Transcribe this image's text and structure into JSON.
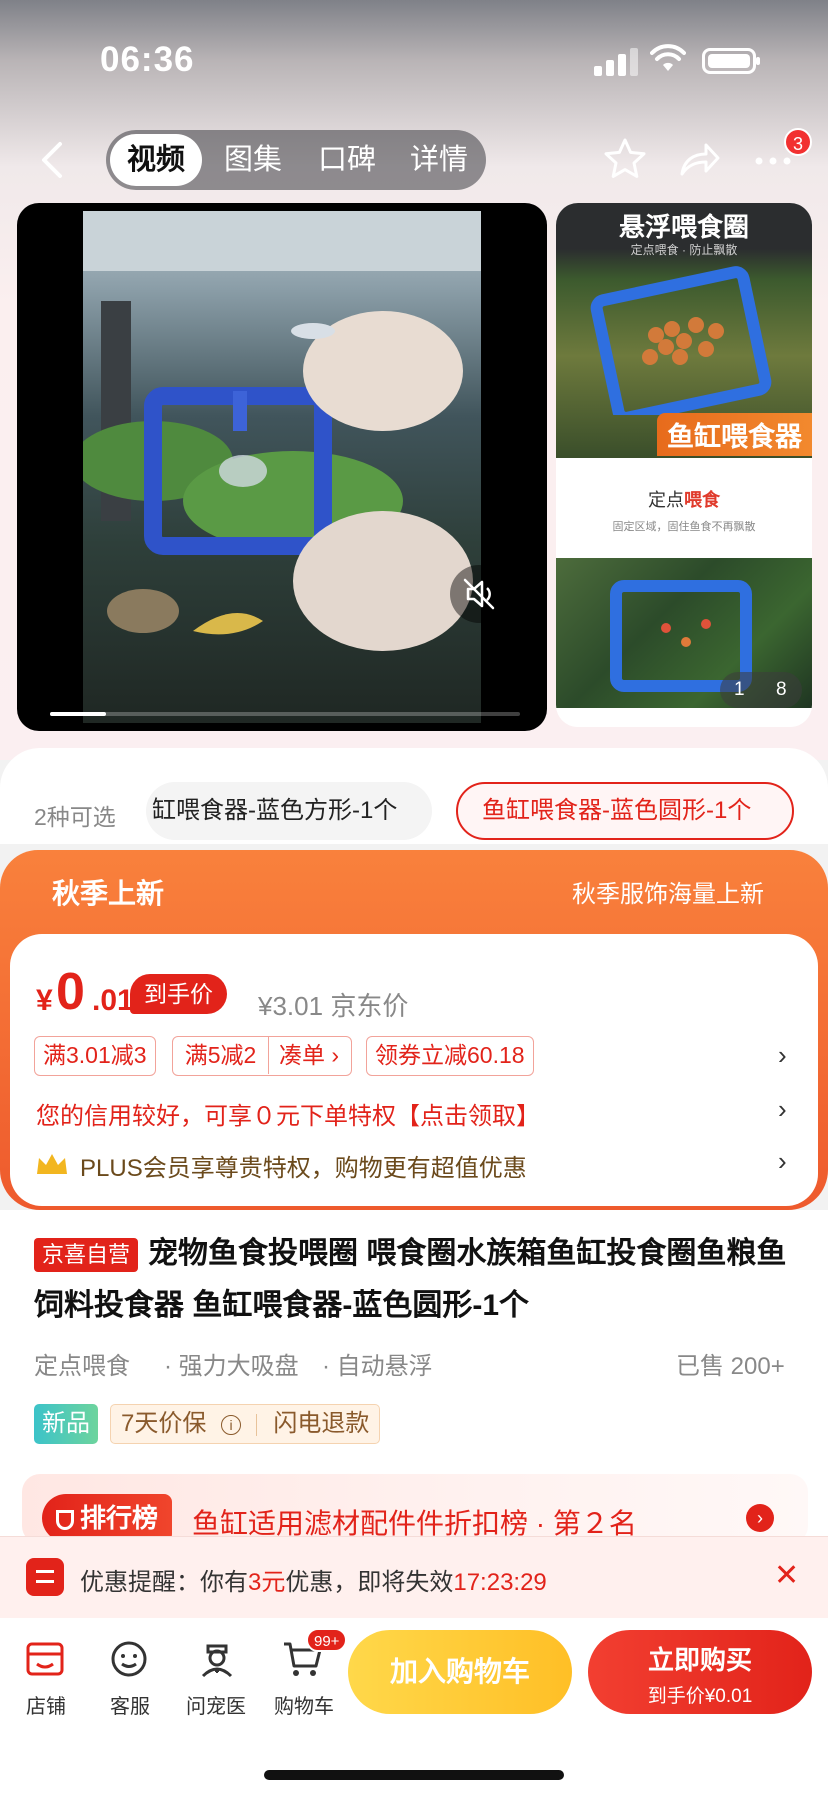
{
  "status_bar": {
    "time": "06:36"
  },
  "nav": {
    "tabs": [
      {
        "label": "视频",
        "active": true
      },
      {
        "label": "图集"
      },
      {
        "label": "口碑"
      },
      {
        "label": "详情"
      }
    ],
    "more_badge": "3"
  },
  "media": {
    "thumb1_title": "悬浮喂食圈",
    "thumb1_sub": "定点喂食 · 防止飘散",
    "thumb1_label": "鱼缸喂食器",
    "thumb2_title_a": "定点",
    "thumb2_title_b": "喂食",
    "thumb2_sub": "固定区域，固住鱼食不再飘散",
    "pager_current": "1",
    "pager_total": "8"
  },
  "variants": {
    "count_label": "2种可选",
    "options": [
      "缸喂食器-蓝色方形-1个",
      "鱼缸喂食器-蓝色圆形-1个"
    ]
  },
  "promo_banner": {
    "left": "秋季上新",
    "right": "秋季服饰海量上新"
  },
  "price": {
    "currency": "¥",
    "integer": "0",
    "decimal": ".01",
    "tag": "到手价",
    "jd_price": "¥3.01",
    "jd_label": "京东价",
    "coupons": [
      "满3.01减3",
      "满5减2",
      "凑单 ›",
      "领券立减60.18"
    ],
    "credit_text": "您的信用较好，可享０元下单特权【点击领取】",
    "plus_text": "PLUS会员享尊贵特权，购物更有超值优惠"
  },
  "product": {
    "self_tag": "京喜自营",
    "title": "宠物鱼食投喂圈 喂食圈水族箱鱼缸投食圈鱼粮鱼饲料投食器 鱼缸喂食器-蓝色圆形-1个",
    "features": [
      "定点喂食",
      "· 强力大吸盘",
      "· 自动悬浮"
    ],
    "sold": "已售 200+",
    "new_tag": "新品",
    "service_a": "7天价保",
    "service_b": "闪电退款"
  },
  "rank": {
    "badge": "排行榜",
    "text": "鱼缸适用滤材配件件折扣榜 · 第２名"
  },
  "reminder": {
    "prefix": "优惠提醒：你有",
    "amount": "3元",
    "middle": "优惠，即将失效",
    "countdown": "17:23:29"
  },
  "bottom_bar": {
    "items": [
      "店铺",
      "客服",
      "问宠医",
      "购物车"
    ],
    "cart_badge": "99+",
    "add_cart": "加入购物车",
    "buy_now": "立即购买",
    "buy_sub": "到手价¥0.01"
  },
  "colors": {
    "brand_red": "#e2231a",
    "accent_orange": "#f9813c",
    "cart_yellow": "#ffc72e"
  }
}
